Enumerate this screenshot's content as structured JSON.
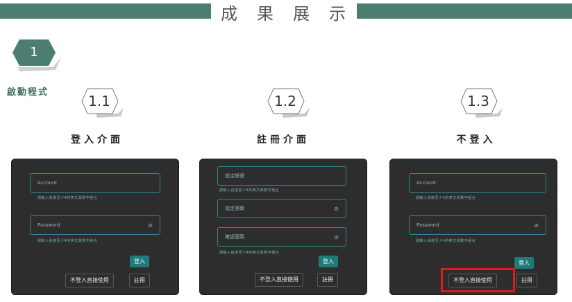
{
  "header": {
    "title_chars": [
      "成",
      "果",
      "展",
      "示"
    ]
  },
  "step": {
    "number": "1",
    "label": "啟動程式"
  },
  "sections": [
    {
      "badge": "1.1",
      "title": "登入介面"
    },
    {
      "badge": "1.2",
      "title": "註冊介面"
    },
    {
      "badge": "1.3",
      "title": "不登入"
    }
  ],
  "login_screen": {
    "account_placeholder": "Account",
    "account_hint": "請輸入長度至少4的英文與數字組合",
    "password_placeholder": "Password",
    "password_hint": "請輸入長度至少4的英文與數字組合",
    "login_label": "登入",
    "guest_label": "不登入直接使用",
    "register_label": "註冊"
  },
  "register_screen": {
    "account_placeholder": "設定帳號",
    "account_hint": "請輸入長度至少4的英文與數字組合",
    "password_placeholder": "設定密碼",
    "confirm_placeholder": "確認密碼",
    "confirm_hint": "請輸入長度至少4的英文與數字組合",
    "login_label": "登入",
    "guest_label": "不登入直接使用",
    "register_label": "註冊"
  },
  "guest_screen": {
    "account_placeholder": "Account",
    "account_hint": "請輸入長度至少4的英文與數字組合",
    "password_placeholder": "Password",
    "password_hint": "請輸入長度至少4的英文與數字組合",
    "login_label": "登入",
    "guest_label": "不登入直接使用",
    "register_label": "註冊"
  },
  "colors": {
    "accent": "#4d7d70",
    "highlight": "#e01b1b",
    "app_bg": "#2d2d2d",
    "field_border": "#2f8a8c"
  }
}
